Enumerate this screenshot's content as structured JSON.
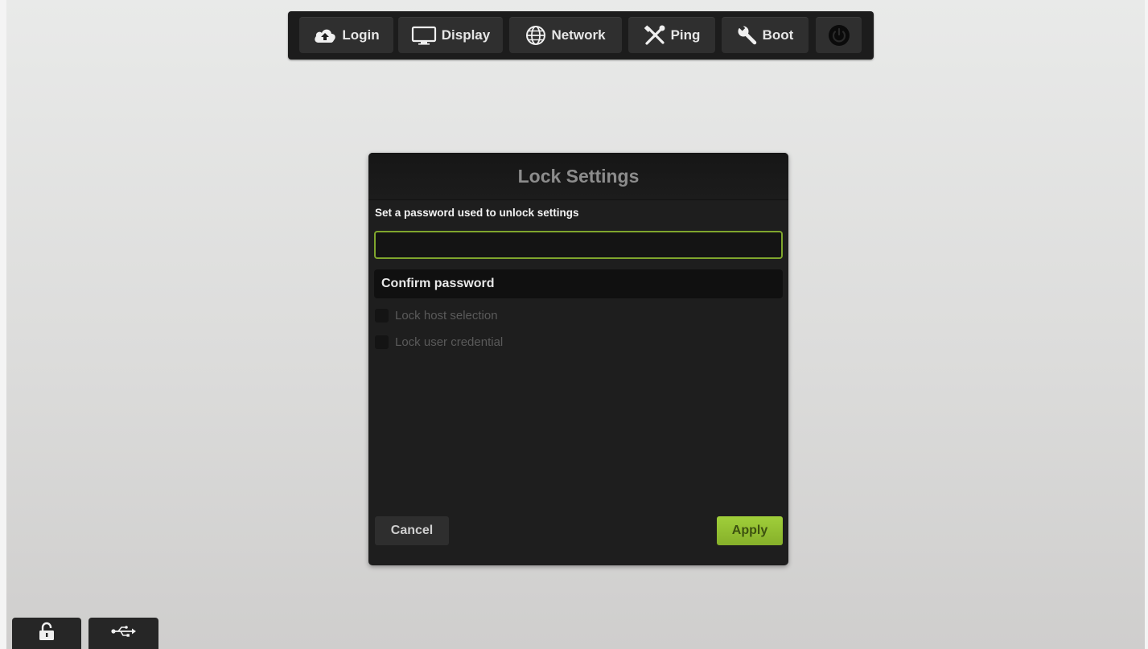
{
  "toolbar": {
    "login_label": "Login",
    "display_label": "Display",
    "network_label": "Network",
    "ping_label": "Ping",
    "boot_label": "Boot",
    "icons": [
      "cloud-upload-icon",
      "monitor-icon",
      "globe-icon",
      "tools-icon",
      "wrench-icon",
      "power-icon"
    ]
  },
  "dialog": {
    "title": "Lock Settings",
    "prompt": "Set a password used to unlock settings",
    "password_value": "",
    "confirm_placeholder": "Confirm password",
    "checkboxes": [
      {
        "label": "Lock host selection",
        "checked": false
      },
      {
        "label": "Lock user credential",
        "checked": false
      }
    ],
    "cancel_label": "Cancel",
    "apply_label": "Apply"
  },
  "bottom_bar": {
    "icons": [
      "lock-open-icon",
      "usb-icon"
    ]
  },
  "colors": {
    "accent_green": "#8fbd2f",
    "dialog_bg": "#1e1e1e",
    "toolbar_bg": "#1c1c1c"
  }
}
